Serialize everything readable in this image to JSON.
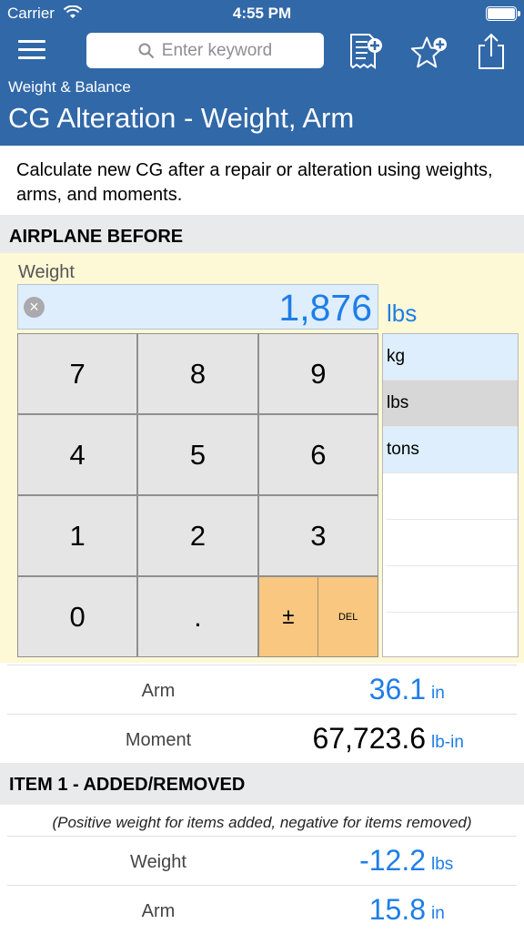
{
  "status_bar": {
    "carrier": "Carrier",
    "time": "4:55 PM"
  },
  "header": {
    "search_placeholder": "Enter keyword",
    "subtitle": "Weight & Balance",
    "title": "CG Alteration - Weight, Arm",
    "bg_color": "#3168a8"
  },
  "description": "Calculate new CG after a repair or alteration using weights, arms, and moments.",
  "airplane_before": {
    "section_title": "AIRPLANE BEFORE",
    "weight_label": "Weight",
    "weight_value": "1,876",
    "weight_unit": "lbs",
    "keypad": {
      "k7": "7",
      "k8": "8",
      "k9": "9",
      "k4": "4",
      "k5": "5",
      "k6": "6",
      "k1": "1",
      "k2": "2",
      "k3": "3",
      "k0": "0",
      "kdot": ".",
      "kpm": "±",
      "kdel": "DEL"
    },
    "units": [
      "kg",
      "lbs",
      "tons"
    ],
    "selected_unit": "lbs",
    "arm_label": "Arm",
    "arm_value": "36.1",
    "arm_unit": "in",
    "moment_label": "Moment",
    "moment_value": "67,723.6",
    "moment_unit": "lb-in"
  },
  "item1": {
    "section_title": "ITEM 1 - ADDED/REMOVED",
    "note": "(Positive weight for items added, negative for items removed)",
    "weight_label": "Weight",
    "weight_value": "-12.2",
    "weight_unit": "lbs",
    "arm_label": "Arm",
    "arm_value": "15.8",
    "arm_unit": "in"
  },
  "colors": {
    "accent_blue": "#1e7ee8",
    "input_bg": "#deeefc",
    "calc_bg": "#fdf8d5",
    "key_orange": "#f9c77f"
  }
}
